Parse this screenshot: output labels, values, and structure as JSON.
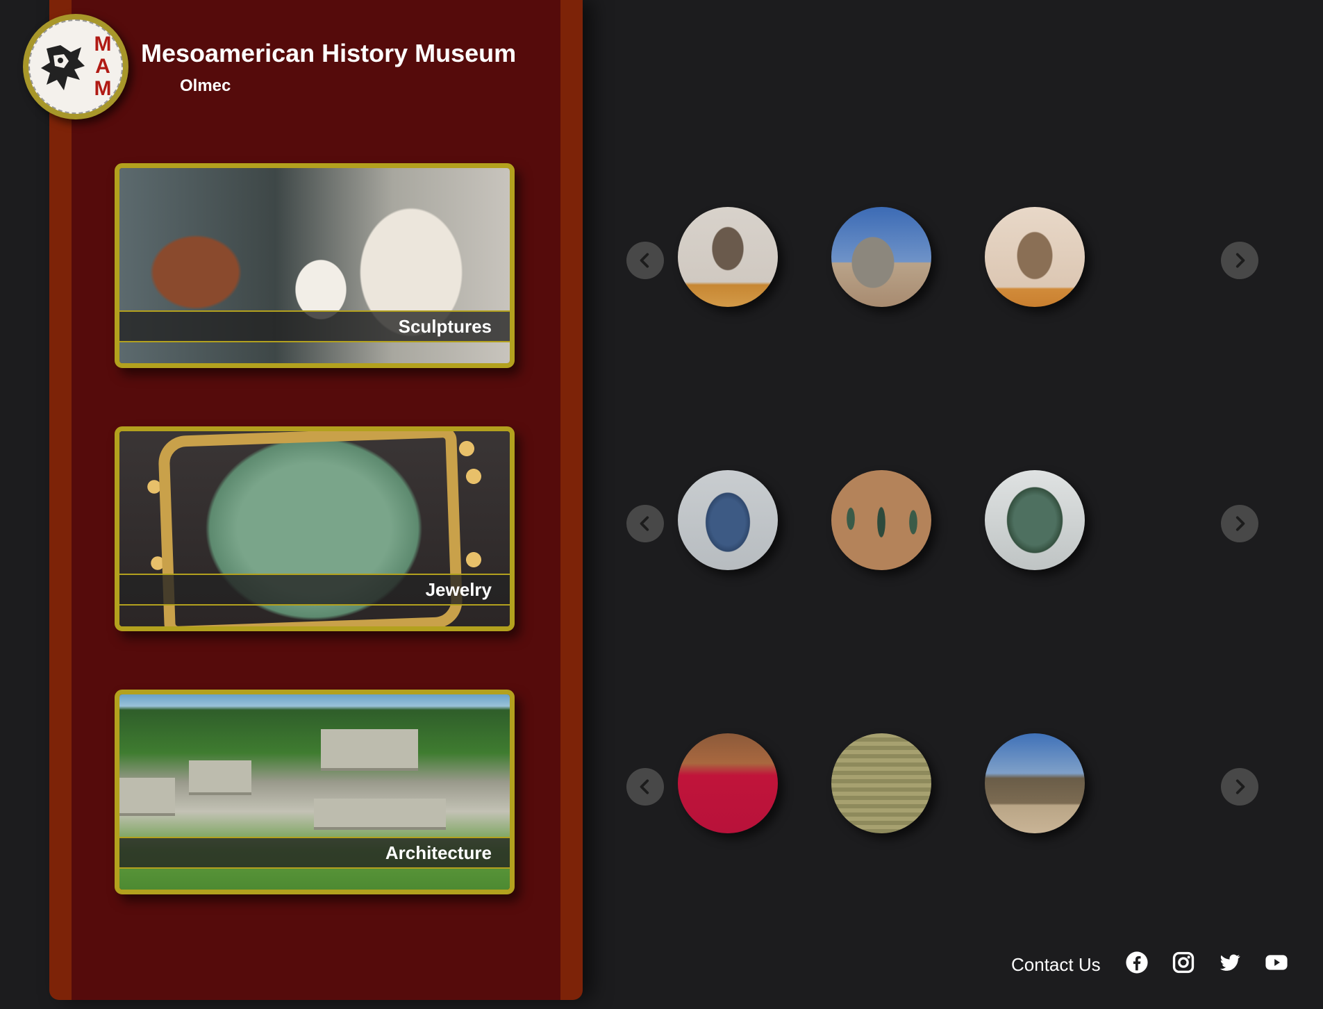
{
  "header": {
    "title": "Mesoamerican History Museum",
    "subtitle": "Olmec",
    "logo_letters": [
      "M",
      "A",
      "M"
    ]
  },
  "categories": [
    {
      "label": "Sculptures"
    },
    {
      "label": "Jewelry"
    },
    {
      "label": "Architecture"
    }
  ],
  "carousels": [
    {
      "category": "Sculptures",
      "items": [
        "seated figure",
        "colossal head",
        "relief stone"
      ]
    },
    {
      "category": "Jewelry",
      "items": [
        "jade hand",
        "jade celts",
        "jade mask"
      ]
    },
    {
      "category": "Architecture",
      "items": [
        "red pit",
        "mosaic pavement",
        "pyramid"
      ]
    }
  ],
  "footer": {
    "contact_label": "Contact Us",
    "social_icons": [
      "facebook-icon",
      "instagram-icon",
      "twitter-icon",
      "youtube-icon"
    ]
  },
  "colors": {
    "page_bg": "#1c1c1e",
    "panel_bg": "#550b0b",
    "panel_border": "#7d2308",
    "card_border": "#b3a11e",
    "nav_button": "#484848",
    "text": "#ffffff"
  }
}
